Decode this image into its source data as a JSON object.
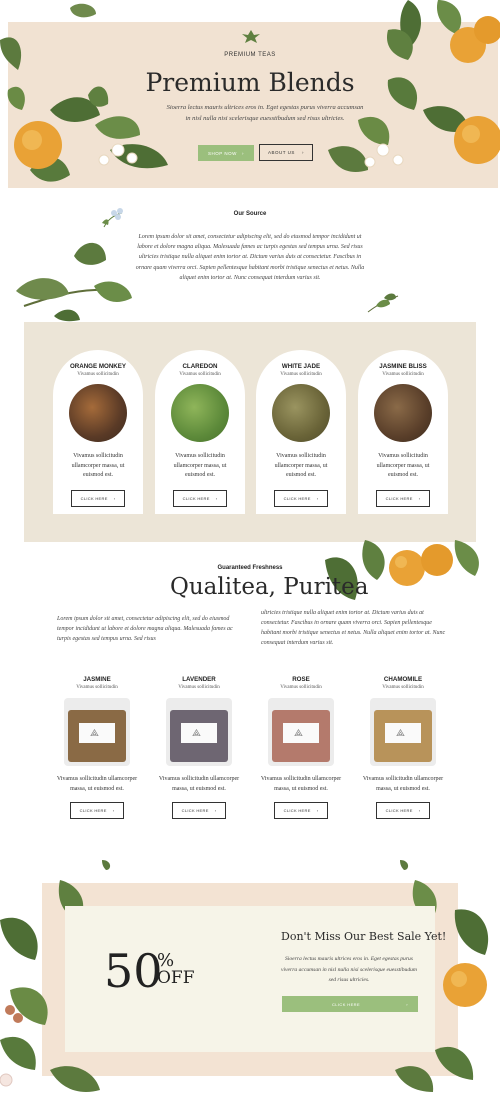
{
  "hero": {
    "eyebrow": "PREMIUM TEAS",
    "title": "Premium Blends",
    "text": "Sioerra lectus mauris ultrices eros in. Eget egestas purus viverra accumsan in nisl nulla nisi scelerisque euesstibudum sed risus ultricies.",
    "primary_button": "SHOP NOW",
    "secondary_button": "ABOUT US",
    "arrow": "›"
  },
  "source": {
    "title": "Our Source",
    "text": "Lorem ipsum dolor sit amet, consectetur adipiscing elit, sed do eiusmod tempor incididunt ut labore et dolore magna aliqua. Malesuada fames ac turpis egestas sed tempus urna. Sed risus ultricies tristique nulla aliquet enim tortor at. Dictum varius duis at consectetur. Fascibus in ornare quam viverra orci. Sapien pellentesque habitant morbi tristique senectus et netus. Nulla aliquet enim tortor at. Nunc consequat interdum varius sit."
  },
  "teas": [
    {
      "name": "ORANGE MONKEY",
      "sub": "Vivamus sollicitudin",
      "desc": "Vivamus sollicitudin ullamcorper massa, ut euismod est.",
      "button": "CLICK HERE",
      "color": "#6b4a33"
    },
    {
      "name": "CLAREDON",
      "sub": "Vivamus sollicitudin",
      "desc": "Vivamus sollicitudin ullamcorper massa, ut euismod est.",
      "button": "CLICK HERE",
      "color": "#5d8a3a"
    },
    {
      "name": "WHITE JADE",
      "sub": "Vivamus sollicitudin",
      "desc": "Vivamus sollicitudin ullamcorper massa, ut euismod est.",
      "button": "CLICK HERE",
      "color": "#6a6438"
    },
    {
      "name": "JASMINE BLISS",
      "sub": "Vivamus sollicitudin",
      "desc": "Vivamus sollicitudin ullamcorper massa, ut euismod est.",
      "button": "CLICK HERE",
      "color": "#5a3f2a"
    }
  ],
  "quality": {
    "eyebrow": "Guaranteed Freshness",
    "title": "Qualitea, Puritea",
    "left_text": "Lorem ipsum dolor sit amet, consectetur adipiscing elit, sed do eiusmod tempor incididunt ut labore et dolore magna aliqua. Malesuada fames ac turpis egestas sed tempus urna. Sed risus",
    "right_text": "ultricies tristique nulla aliquet enim tortor at. Dictum varius duis at consectetur. Fascibus in ornare quam viverra orci. Sapien pellentesque habitant morbi tristique senectus et netus. Nulla aliquet enim tortor at. Nunc consequat interdum varius sit."
  },
  "bags": [
    {
      "name": "JASMINE",
      "sub": "Vivamus sollicitudin",
      "desc": "Vivamus sollicitudin ullamcorper massa, ut euismod est.",
      "button": "CLICK HERE",
      "color": "#8a6a45"
    },
    {
      "name": "LAVENDER",
      "sub": "Vivamus sollicitudin",
      "desc": "Vivamus sollicitudin ullamcorper massa, ut euismod est.",
      "button": "CLICK HERE",
      "color": "#6e6672"
    },
    {
      "name": "ROSE",
      "sub": "Vivamus sollicitudin",
      "desc": "Vivamus sollicitudin ullamcorper massa, ut euismod est.",
      "button": "CLICK HERE",
      "color": "#b47a6c"
    },
    {
      "name": "CHAMOMILE",
      "sub": "Vivamus sollicitudin",
      "desc": "Vivamus sollicitudin ullamcorper massa, ut euismod est.",
      "button": "CLICK HERE",
      "color": "#b8935a"
    }
  ],
  "sale": {
    "number": "50",
    "percent": "%",
    "off": "OFF",
    "title": "Don't Miss Our Best Sale Yet!",
    "text": "Sioerra lectus mauris ultrices eros in. Eget egestas purus viverra accumsan in nisl nulla nisi scelerisque euesstibudum sed risus ultricies.",
    "button": "CLICK HERE"
  },
  "colors": {
    "accent_green": "#9bbf7d",
    "hero_bg": "#f1e2d2",
    "band_bg": "#ece5d7",
    "sale_bg": "#f3e3d3"
  }
}
